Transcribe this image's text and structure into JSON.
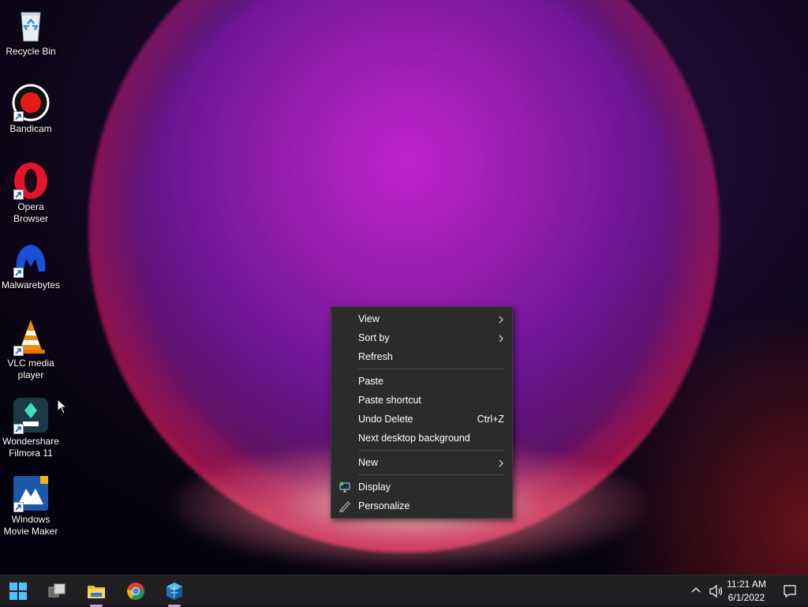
{
  "desktop": {
    "icons": [
      {
        "label": "Recycle Bin"
      },
      {
        "label": "Bandicam"
      },
      {
        "label": "Opera Browser"
      },
      {
        "label": "Malwarebytes"
      },
      {
        "label": "VLC media player"
      },
      {
        "label": "Wondershare Filmora 11"
      },
      {
        "label": "Windows Movie Maker"
      }
    ]
  },
  "context_menu": {
    "items": [
      {
        "label": "View",
        "submenu": true
      },
      {
        "label": "Sort by",
        "submenu": true
      },
      {
        "label": "Refresh"
      },
      {
        "label": "Paste"
      },
      {
        "label": "Paste shortcut"
      },
      {
        "label": "Undo Delete",
        "shortcut": "Ctrl+Z"
      },
      {
        "label": "Next desktop background"
      },
      {
        "label": "New",
        "submenu": true
      },
      {
        "label": "Display",
        "icon": "display-settings-icon"
      },
      {
        "label": "Personalize",
        "icon": "pen-icon"
      }
    ]
  },
  "taskbar": {
    "apps": [
      {
        "name": "start-button",
        "icon": "windows-logo-icon"
      },
      {
        "name": "task-view-button",
        "icon": "task-view-icon"
      },
      {
        "name": "file-explorer-button",
        "icon": "folder-icon",
        "running": true
      },
      {
        "name": "chrome-button",
        "icon": "chrome-icon"
      },
      {
        "name": "app-button",
        "icon": "app-cube-icon",
        "running": true
      }
    ],
    "clock": {
      "time": "11:21 AM",
      "date": "6/1/2022"
    },
    "tray_icons": [
      "chevron-up-icon",
      "speaker-icon",
      "notification-icon"
    ]
  },
  "colors": {
    "menu_bg": "#2b2b2b",
    "taskbar_bg": "#1f1f22",
    "accent": "#c9a0d8"
  }
}
